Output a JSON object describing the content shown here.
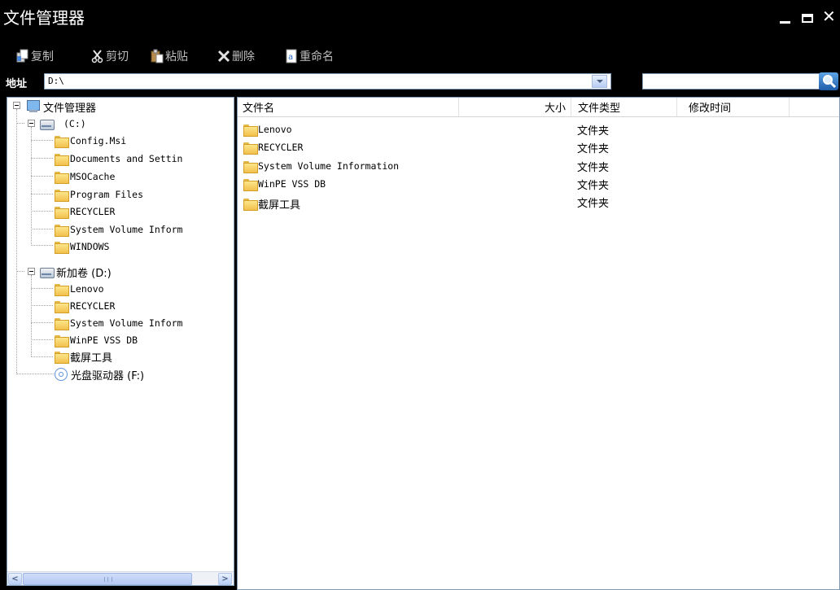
{
  "window": {
    "title": "文件管理器"
  },
  "toolbar": {
    "copy_label": "复制",
    "cut_label": "剪切",
    "paste_label": "粘贴",
    "delete_label": "删除",
    "rename_label": "重命名"
  },
  "address": {
    "label": "地址",
    "value": "D:\\",
    "search_value": ""
  },
  "tree": {
    "root_label": "文件管理器",
    "drive_c_label": "(C:)",
    "drive_c_children": [
      "Config.Msi",
      "Documents and Settin",
      "MSOCache",
      "Program Files",
      "RECYCLER",
      "System Volume Inform",
      "WINDOWS"
    ],
    "drive_d_label": "新加卷 (D:)",
    "drive_d_children": [
      "Lenovo",
      "RECYCLER",
      "System Volume Inform",
      "WinPE VSS DB",
      "截屏工具"
    ],
    "drive_f_label": "光盘驱动器 (F:)"
  },
  "list": {
    "columns": {
      "name": "文件名",
      "size": "大小",
      "type": "文件类型",
      "mtime": "修改时间"
    },
    "rows": [
      {
        "name": "Lenovo",
        "size": "",
        "type": "文件夹",
        "mtime": ""
      },
      {
        "name": "RECYCLER",
        "size": "",
        "type": "文件夹",
        "mtime": ""
      },
      {
        "name": "System Volume Information",
        "size": "",
        "type": "文件夹",
        "mtime": ""
      },
      {
        "name": "WinPE VSS DB",
        "size": "",
        "type": "文件夹",
        "mtime": ""
      },
      {
        "name": "截屏工具",
        "size": "",
        "type": "文件夹",
        "mtime": ""
      }
    ]
  },
  "icons": {
    "minimize": "minimize-icon",
    "maximize": "maximize-icon",
    "close": "close-icon",
    "copy": "copy-icon",
    "cut": "scissors-icon",
    "paste": "paste-icon",
    "delete": "delete-x-icon",
    "rename": "rename-icon",
    "search": "magnifier-icon",
    "folder": "folder-icon",
    "drive": "hard-drive-icon",
    "computer": "computer-icon",
    "cdrom": "cd-drive-icon"
  },
  "colors": {
    "chrome_background": "#000000",
    "toolbar_text": "#bdbdbd",
    "panel_border": "#7f9db9",
    "folder_yellow": "#f1c04d"
  }
}
